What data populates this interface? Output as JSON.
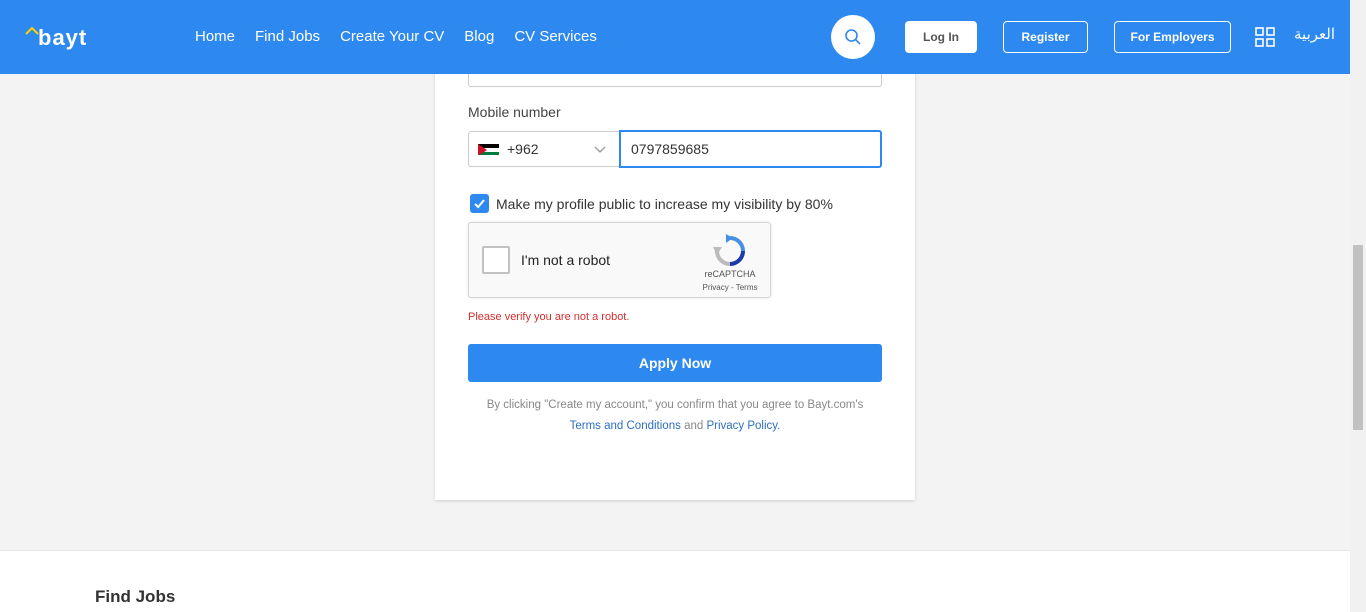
{
  "header": {
    "logo_text": "bayt",
    "nav": [
      "Home",
      "Find Jobs",
      "Create Your CV",
      "Blog",
      "CV Services"
    ],
    "login_label": "Log In",
    "register_label": "Register",
    "employers_label": "For Employers",
    "language_label": "العربية"
  },
  "form": {
    "mobile_label": "Mobile number",
    "country_code": "+962",
    "phone_value": "0797859685",
    "public_profile_label": "Make my profile public to increase my visibility by 80%",
    "public_profile_checked": true,
    "recaptcha": {
      "label": "I'm not a robot",
      "brand": "reCAPTCHA",
      "links": "Privacy - Terms"
    },
    "error": "Please verify you are not a robot.",
    "apply_label": "Apply Now",
    "terms_prefix": "By clicking \"Create my account,\" you confirm that you agree to Bayt.com's",
    "terms_link": "Terms and Conditions",
    "terms_and": "and",
    "privacy_link": "Privacy Policy."
  },
  "footer": {
    "title": "Find Jobs"
  },
  "colors": {
    "brand": "#2d88f0",
    "error": "#d32f2f",
    "link": "#2d6fc0"
  }
}
